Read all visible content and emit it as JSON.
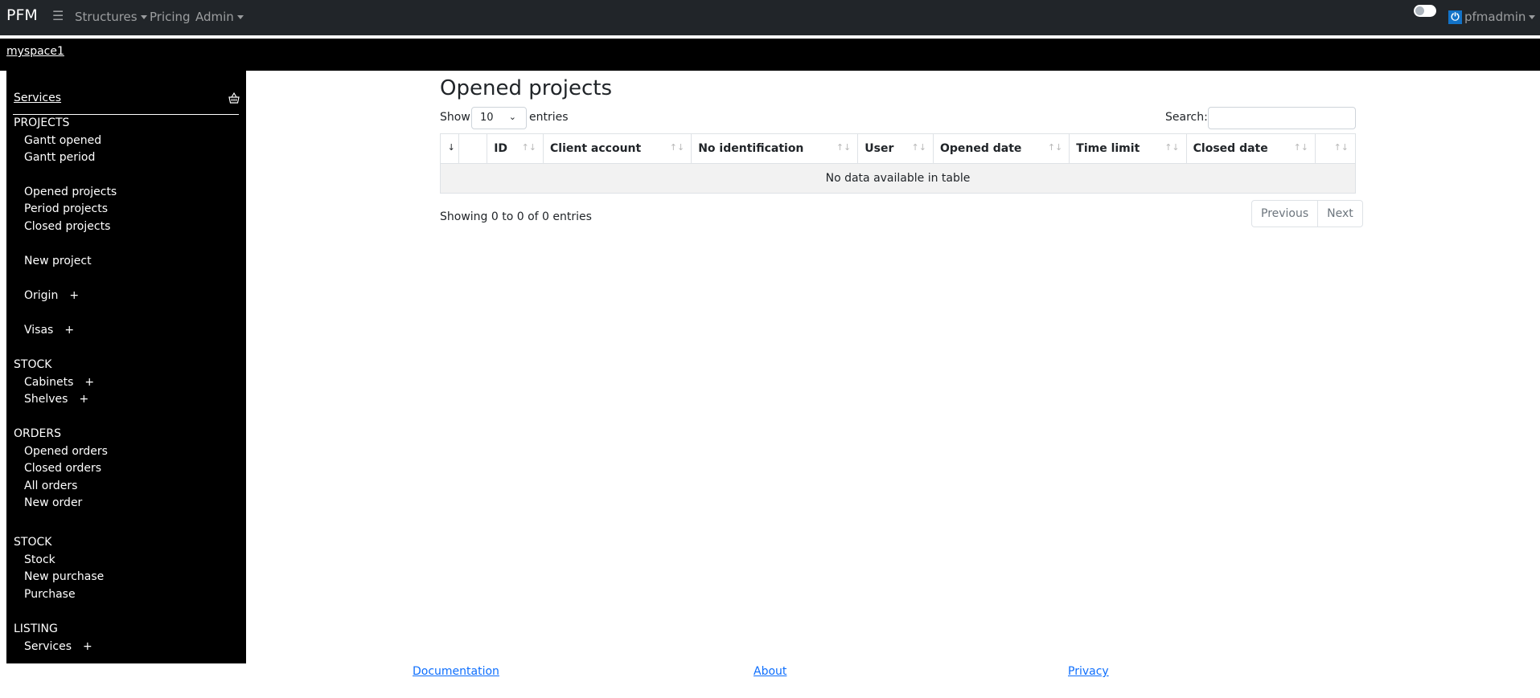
{
  "navbar": {
    "brand": "PFM",
    "menu_icon": "hamburger-icon",
    "items": [
      {
        "label": "Structures",
        "dropdown": true
      },
      {
        "label": "Pricing",
        "dropdown": false
      },
      {
        "label": "Admin",
        "dropdown": true
      }
    ],
    "theme_toggle": {
      "on": false
    },
    "user": {
      "icon": "power-icon",
      "name": "pfmadmin",
      "dropdown": true
    }
  },
  "space": {
    "label": "myspace1"
  },
  "sidebar": {
    "services_link": "Services",
    "services_icon": "basket-icon",
    "sections": [
      {
        "heading": "PROJECTS",
        "items": [
          {
            "label": "Gantt opened"
          },
          {
            "label": "Gantt period"
          },
          {
            "label": "Opened projects"
          },
          {
            "label": "Period projects"
          },
          {
            "label": "Closed projects"
          },
          {
            "label": "New project"
          },
          {
            "label": "Origin",
            "plus": "+"
          },
          {
            "label": "Visas",
            "plus": "+"
          }
        ]
      },
      {
        "heading": "STOCK",
        "items": [
          {
            "label": "Cabinets",
            "plus": "+"
          },
          {
            "label": "Shelves",
            "plus": "+"
          }
        ]
      },
      {
        "heading": "ORDERS",
        "items": [
          {
            "label": "Opened orders"
          },
          {
            "label": "Closed orders"
          },
          {
            "label": "All orders"
          },
          {
            "label": "New order"
          }
        ]
      },
      {
        "heading": "STOCK",
        "items": [
          {
            "label": "Stock"
          },
          {
            "label": "New purchase"
          },
          {
            "label": "Purchase"
          }
        ]
      },
      {
        "heading": "LISTING",
        "items": [
          {
            "label": "Services",
            "plus": "+"
          }
        ]
      }
    ]
  },
  "main": {
    "title": "Opened projects",
    "length": {
      "show": "Show",
      "value": "10",
      "entries": "entries"
    },
    "search": {
      "label": "Search:",
      "value": "",
      "placeholder": ""
    },
    "table": {
      "columns": [
        "",
        "",
        "ID",
        "Client account",
        "No identification",
        "User",
        "Opened date",
        "Time limit",
        "Closed date",
        ""
      ],
      "sort_glyph": "↑↓",
      "active_sort_glyph": "↓",
      "empty_message": "No data available in table"
    },
    "info": "Showing 0 to 0 of 0 entries",
    "pagination": {
      "previous": "Previous",
      "next": "Next"
    }
  },
  "footer": {
    "links": [
      "Documentation",
      "About",
      "Privacy"
    ]
  },
  "colors": {
    "navbar": "#212529",
    "sidebar": "#000000",
    "link": "#0d6efd",
    "power_icon": "#1273c8"
  }
}
